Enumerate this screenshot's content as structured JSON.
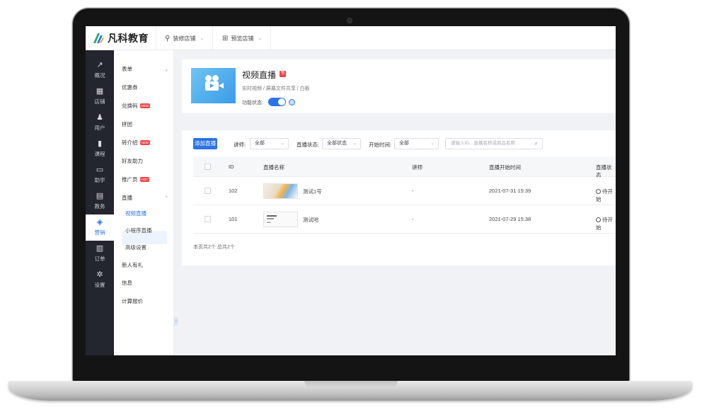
{
  "app": {
    "brand": "凡科教育",
    "top_items": [
      {
        "label": "装修店铺",
        "icon": "paint-icon"
      },
      {
        "label": "预览店铺",
        "icon": "grid-icon"
      }
    ]
  },
  "rail": {
    "items": [
      {
        "label": "概况",
        "icon": "chart-icon",
        "glyph": "↗"
      },
      {
        "label": "店铺",
        "icon": "store-icon",
        "glyph": "▦"
      },
      {
        "label": "用户",
        "icon": "users-icon",
        "glyph": "♟"
      },
      {
        "label": "课程",
        "icon": "book-icon",
        "glyph": "▮"
      },
      {
        "label": "助学",
        "icon": "board-icon",
        "glyph": "▭"
      },
      {
        "label": "教务",
        "icon": "calendar-icon",
        "glyph": "▤"
      },
      {
        "label": "营销",
        "icon": "tag-icon",
        "glyph": "◈"
      },
      {
        "label": "订单",
        "icon": "order-icon",
        "glyph": "▥"
      },
      {
        "label": "设置",
        "icon": "gear-icon",
        "glyph": "✲"
      }
    ]
  },
  "submenu": {
    "items": [
      {
        "label": "表单",
        "badge": ""
      },
      {
        "label": "优惠券",
        "badge": ""
      },
      {
        "label": "兑换码",
        "badge": "NEW"
      },
      {
        "label": "拼团",
        "badge": ""
      },
      {
        "label": "转介绍",
        "badge": "NEW"
      },
      {
        "label": "好友助力",
        "badge": ""
      },
      {
        "label": "推广员",
        "badge": "HOT"
      },
      {
        "label": "直播",
        "badge": ""
      },
      {
        "label": "视频直播",
        "badge": ""
      },
      {
        "label": "小程序直播",
        "badge": ""
      },
      {
        "label": "高级设置",
        "badge": ""
      },
      {
        "label": "新人有礼",
        "badge": ""
      },
      {
        "label": "信息",
        "badge": ""
      },
      {
        "label": "计算报价",
        "badge": ""
      }
    ]
  },
  "header": {
    "title": "视频直播",
    "tag": "专",
    "subtitle": "实时视频 / 屏幕文件共享 / 白板",
    "status_label": "功能状态:",
    "status_on": true
  },
  "filters": {
    "add_button": "添加直播",
    "teacher_label": "讲师:",
    "teacher_value": "全部",
    "status_label": "直播状态:",
    "status_value": "全部状态",
    "start_label": "开始时间:",
    "start_value": "全部",
    "search_placeholder": "请输入ID、直播名称或商品名称"
  },
  "table": {
    "columns": [
      "ID",
      "直播名称",
      "讲师",
      "直播开始时间",
      "直播状态"
    ],
    "rows": [
      {
        "id": "102",
        "name": "测试1号",
        "teacher": "-",
        "start": "2021-07-31 15:39",
        "status": "待开始"
      },
      {
        "id": "101",
        "name": "测试哈",
        "teacher": "-",
        "start": "2021-07-29 15:38",
        "status": "待开始"
      }
    ],
    "footer": "本页共2个 总共2个"
  }
}
